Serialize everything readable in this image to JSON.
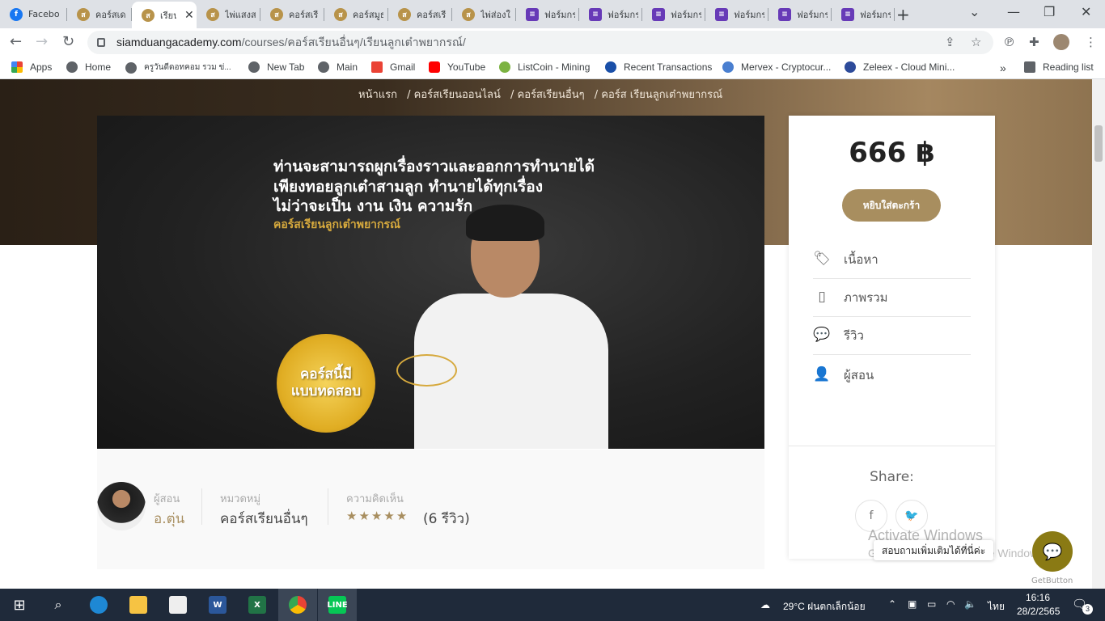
{
  "browser": {
    "tabs": [
      {
        "title": "Facebook",
        "icon": "facebook-icon"
      },
      {
        "title": "คอร์สเด",
        "icon": "siamduang-icon"
      },
      {
        "title": "เรียน",
        "icon": "siamduang-icon",
        "active": true
      },
      {
        "title": "ไพ่แสงส",
        "icon": "siamduang-icon"
      },
      {
        "title": "คอร์สเรี",
        "icon": "siamduang-icon"
      },
      {
        "title": "คอร์สมูธ",
        "icon": "siamduang-icon"
      },
      {
        "title": "คอร์สเรี",
        "icon": "siamduang-icon"
      },
      {
        "title": "ไพ่ส่องใ",
        "icon": "siamduang-icon"
      },
      {
        "title": "ฟอร์มกร",
        "icon": "forms-icon"
      },
      {
        "title": "ฟอร์มกร",
        "icon": "forms-icon"
      },
      {
        "title": "ฟอร์มกร",
        "icon": "forms-icon"
      },
      {
        "title": "ฟอร์มกร",
        "icon": "forms-icon"
      },
      {
        "title": "ฟอร์มกร",
        "icon": "forms-icon"
      },
      {
        "title": "ฟอร์มกร",
        "icon": "forms-icon"
      }
    ],
    "url_host": "siamduangacademy.com",
    "url_path": "/courses/คอร์สเรียนอื่นๆ/เรียนลูกเต๋าพยากรณ์/",
    "bookmarks": [
      {
        "label": "Apps",
        "color": "#ea4335"
      },
      {
        "label": "Home",
        "color": "#5f6368"
      },
      {
        "label": "ครูวันดีดอทคอม รวม ข่...",
        "color": "#5f6368"
      },
      {
        "label": "New Tab",
        "color": "#5f6368"
      },
      {
        "label": "Main",
        "color": "#5f6368"
      },
      {
        "label": "Gmail",
        "color": "#ea4335"
      },
      {
        "label": "YouTube",
        "color": "#ff0000"
      },
      {
        "label": "ListCoin - Mining",
        "color": "#7cb342"
      },
      {
        "label": "Recent Transactions",
        "color": "#1a4fa8"
      },
      {
        "label": "Mervex - Cryptocur...",
        "color": "#4a7fd0"
      },
      {
        "label": "Zeleex - Cloud Mini...",
        "color": "#2d4b9a"
      }
    ],
    "reading_list": "Reading list",
    "more_bookmarks": "»"
  },
  "breadcrumb": [
    "หน้าแรก",
    "/ คอร์สเรียนออนไลน์",
    "/ คอร์สเรียนอื่นๆ",
    "/ คอร์ส เรียนลูกเต๋าพยากรณ์"
  ],
  "banner": {
    "line1": "ท่านจะสามารถผูกเรื่องราวและออกการทำนายได้",
    "line2": "เพียงทอยลูกเต๋าสามลูก ทำนายได้ทุกเรื่อง",
    "line3": "ไม่ว่าจะเป็น งาน เงิน ความรัก",
    "subtitle": "คอร์สเรียนลูกเต๋าพยากรณ์",
    "badge_line1": "คอร์สนี้มี",
    "badge_line2": "แบบทดสอบ"
  },
  "course": {
    "instructor_label": "ผู้สอน",
    "instructor_name": "อ.ตุ่น",
    "category_label": "หมวดหมู่",
    "category_value": "คอร์สเรียนอื่นๆ",
    "reviews_label": "ความคิดเห็น",
    "rating": 5,
    "reviews_text": "(6 รีวิว)"
  },
  "sidebar": {
    "price": "666 ฿",
    "cart_button": "หยิบใส่ตะกร้า",
    "menu": [
      {
        "label": "เนื้อหา",
        "icon": "tag-icon"
      },
      {
        "label": "ภาพรวม",
        "icon": "document-icon"
      },
      {
        "label": "รีวิว",
        "icon": "chat-icon"
      },
      {
        "label": "ผู้สอน",
        "icon": "user-icon"
      }
    ],
    "share_label": "Share:"
  },
  "chat": {
    "bubble": "สอบถามเพิ่มเติมได้ที่นี่ค่ะ",
    "powered": "GetButton"
  },
  "watermark": {
    "line1": "Activate Windows",
    "line2": "Go to Settings to activate Windows."
  },
  "taskbar": {
    "weather": "29°C ฝนตกเล็กน้อย",
    "lang": "ไทย",
    "time": "16:16",
    "date": "28/2/2565",
    "notifications": "3"
  }
}
